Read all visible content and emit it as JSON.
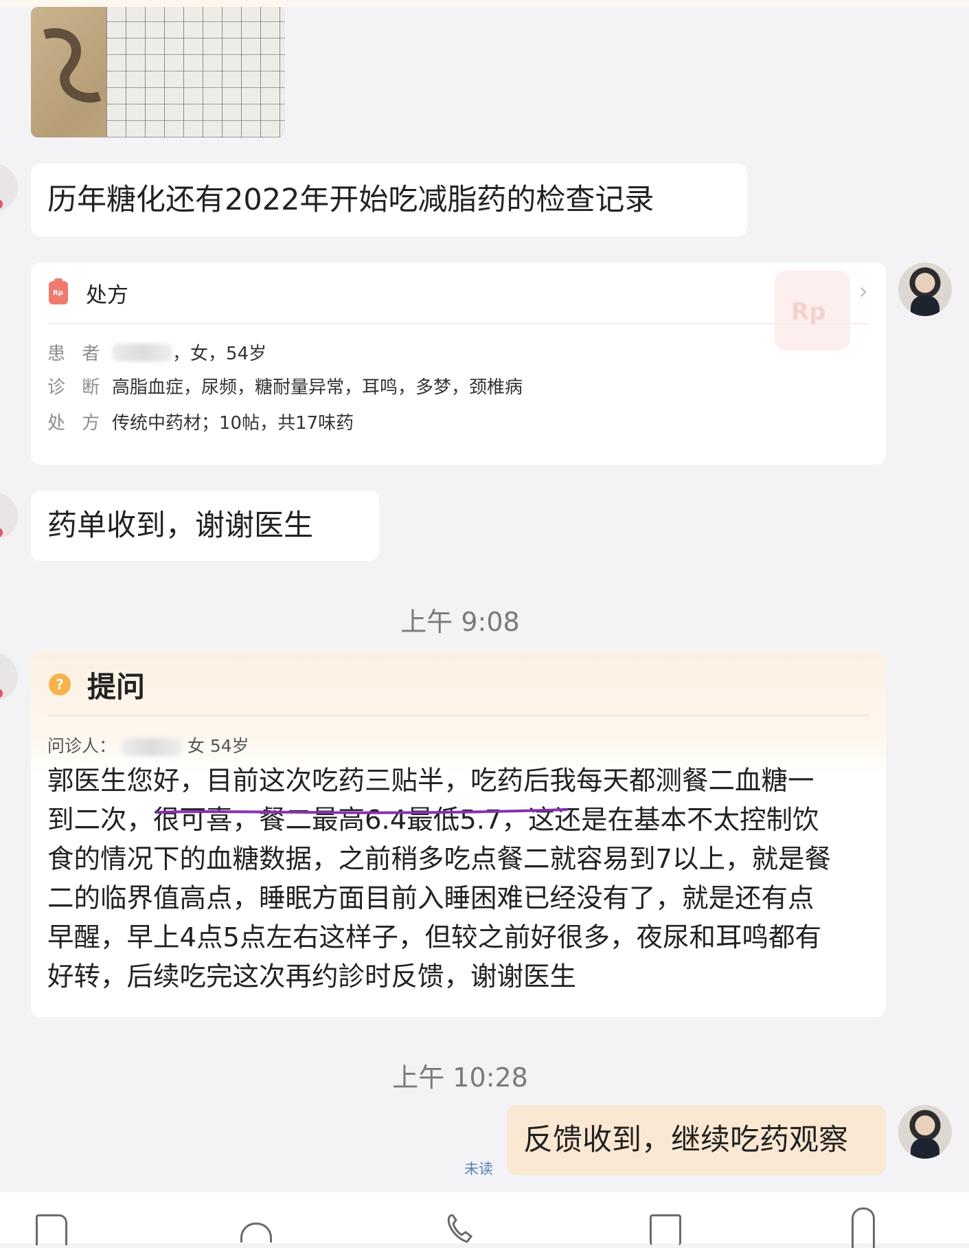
{
  "messages": {
    "m1_text": "历年糖化还有2022年开始吃减脂药的检查记录",
    "m2_text": "药单收到，谢谢医生",
    "m3_text": "反馈收到，继续吃药观察"
  },
  "prescription": {
    "title": "处方",
    "watermark": "Rp",
    "patient_label": "患 者",
    "patient_value": "，女，54岁",
    "diagnosis_label": "诊 断",
    "diagnosis_value": "高脂血症，尿频，糖耐量异常，耳鸣，多梦，颈椎病",
    "rx_label": "处 方",
    "rx_value": "传统中药材；10帖，共17味药"
  },
  "times": {
    "t1": "上午 9:08",
    "t2": "上午 10:28"
  },
  "question": {
    "icon": "?",
    "title": "提问",
    "patient_label": "问诊人：",
    "patient_value": "女 54岁",
    "body": "郭医生您好，目前这次吃药三贴半，吃药后我每天都测餐二血糖一\n到二次，很可喜，餐二最高6.4最低5.7，这还是在基本不太控制饮\n食的情况下的血糖数据，之前稍多吃点餐二就容易到7以上，就是餐\n二的临界值高点，睡眠方面目前入睡困难已经没有了，就是还有点\n早醒，早上4点5点左右这样子，但较之前好很多，夜尿和耳鸣都有\n好转，后续吃完这次再约診时反馈，谢谢医生"
  },
  "status": {
    "unread": "未读"
  },
  "colors": {
    "background": "#f3f3f6",
    "mine_bubble": "#fbe8d2",
    "underline": "#8a2fb3",
    "unread": "#5a7fb6"
  },
  "icons": {
    "nav": [
      "question-doc-icon",
      "bowl-icon",
      "phone-icon",
      "gift-icon",
      "paperclip-icon"
    ]
  }
}
